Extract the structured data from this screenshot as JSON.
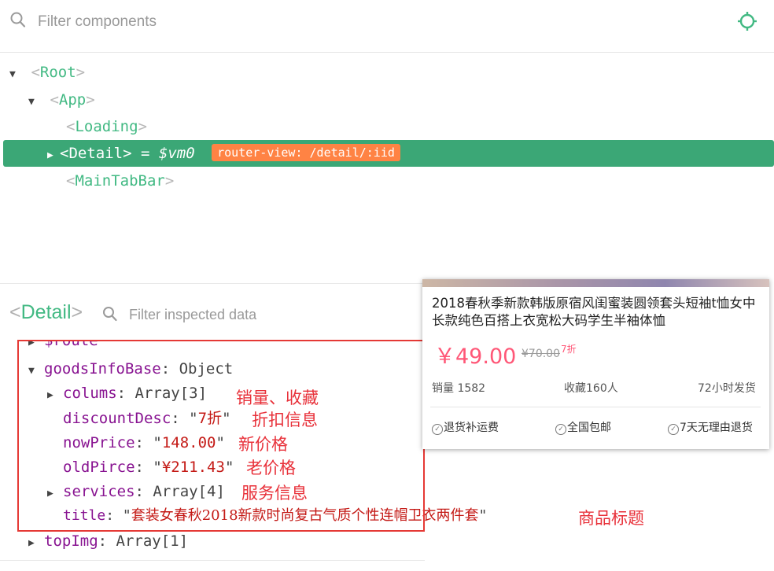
{
  "top_search": {
    "placeholder": "Filter components"
  },
  "tree": {
    "root": "Root",
    "app": "App",
    "loading": "Loading",
    "detail": "Detail",
    "detail_eq": "=",
    "detail_vm": "$vm0",
    "detail_badge": "router-view: /detail/:iid",
    "maintabbar": "MainTabBar"
  },
  "inspector": {
    "title": "Detail",
    "placeholder": "Filter inspected data",
    "route_key": "$route",
    "goods_key": "goodsInfoBase",
    "goods_val": "Object",
    "colums_key": "colums",
    "colums_val": "Array[3]",
    "discount_key": "discountDesc",
    "discount_val": "7折",
    "nowprice_key": "nowPrice",
    "nowprice_val": "148.00",
    "oldpirce_key": "oldPirce",
    "oldpirce_val": "¥211.43",
    "services_key": "services",
    "services_val": "Array[4]",
    "title_key": "title",
    "title_val": "套装女春秋2018新款时尚复古气质个性连帽卫衣两件套",
    "topimg_key": "topImg",
    "topimg_val": "Array[1]"
  },
  "annotations": {
    "colums": "销量、收藏",
    "discount": "折扣信息",
    "nowprice": "新价格",
    "oldprice": "老价格",
    "services": "服务信息",
    "title": "商品标题"
  },
  "card": {
    "title": "2018春秋季新款韩版原宿风闺蜜装圆领套头短袖t恤女中长款纯色百搭上衣宽松大码学生半袖体恤",
    "price": "￥49.00",
    "old_price": "¥70.00",
    "discount": "7折",
    "sales": "销量 1582",
    "favorites": "收藏160人",
    "shipping": "72小时发货",
    "services": [
      "退货补运费",
      "全国包邮",
      "7天无理由退货"
    ]
  },
  "colors": {
    "vue_green": "#42b983",
    "selected_row": "#3ba776",
    "badge_orange": "#ff8344",
    "annotation_red": "#e8313a",
    "price_pink": "#ff5777"
  },
  "icons": {
    "top_search": "search-icon",
    "target": "crosshair-target-icon",
    "inspect_search": "search-icon",
    "check": "check-circle-icon"
  }
}
